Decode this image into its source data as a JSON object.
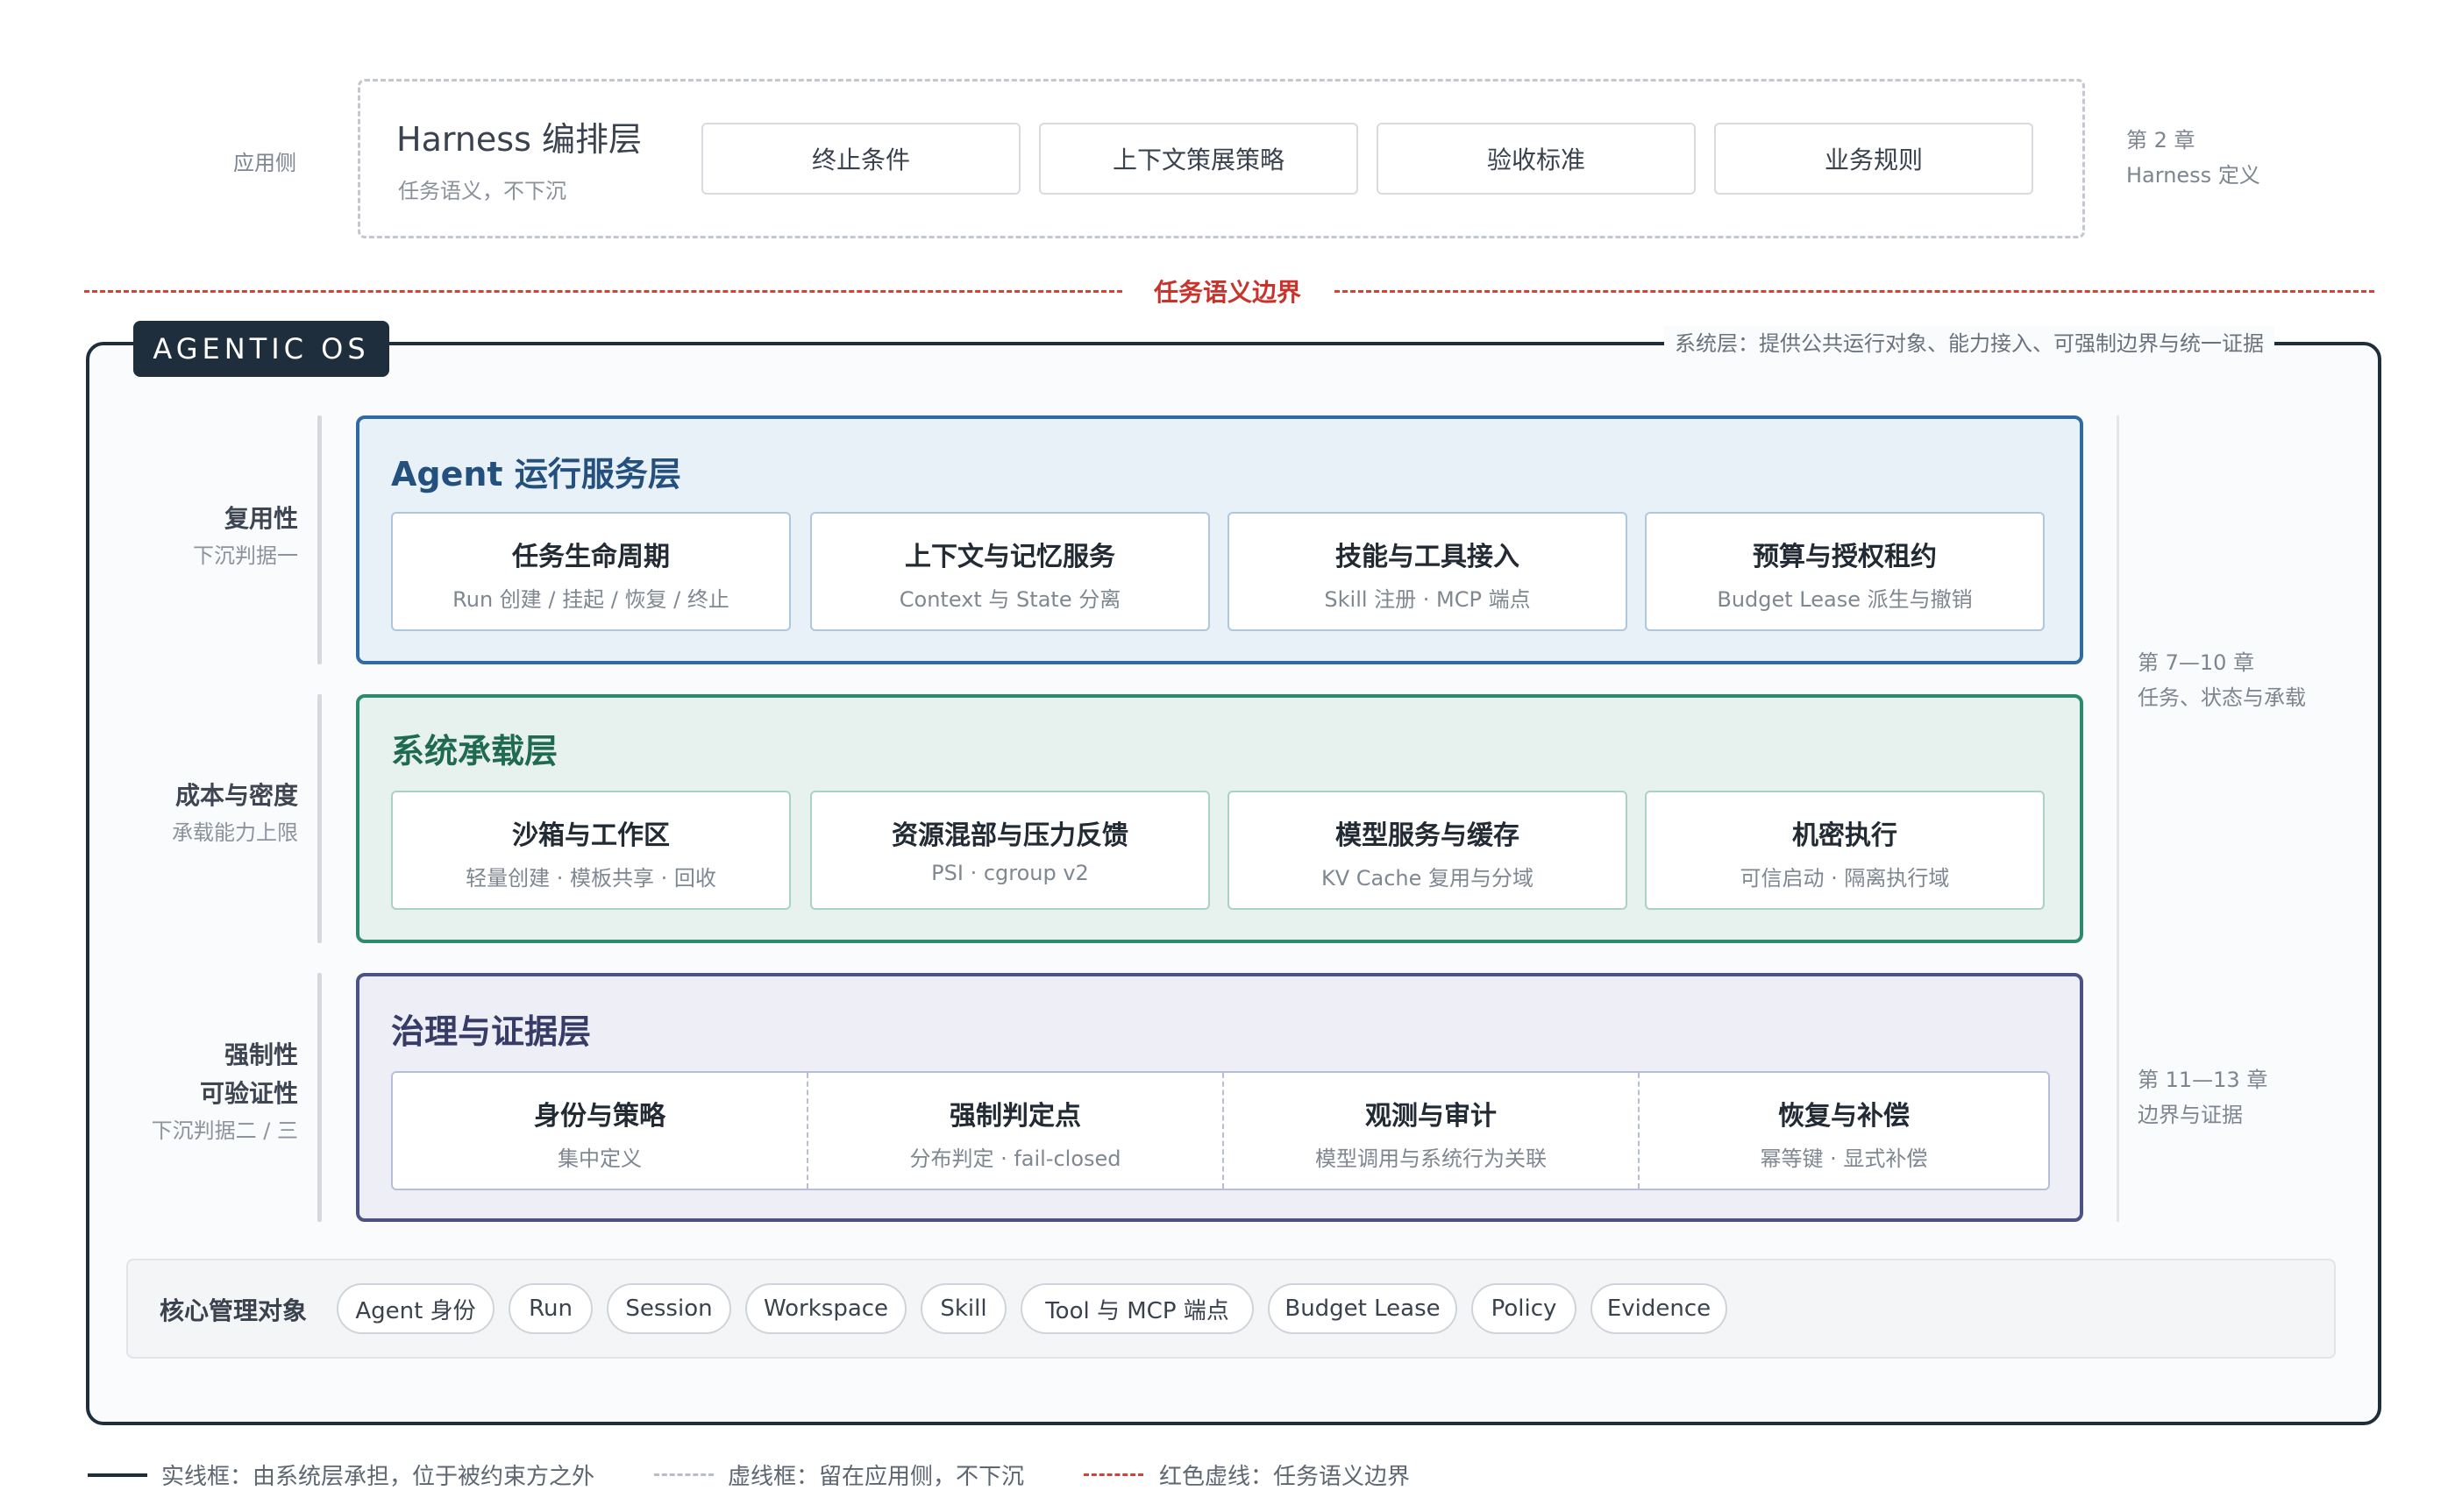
{
  "app_side": {
    "label": "应用侧"
  },
  "harness": {
    "title": "Harness 编排层",
    "subtitle": "任务语义，不下沉",
    "chips": [
      "终止条件",
      "上下文策展策略",
      "验收标准",
      "业务规则"
    ],
    "ref": [
      "第 2 章",
      "Harness 定义"
    ]
  },
  "boundary": {
    "label": "任务语义边界",
    "color": "#d4413a"
  },
  "os": {
    "tag": "AGENTIC OS",
    "note": "系统层：提供公共运行对象、能力接入、可强制边界与统一证据"
  },
  "left_labels": [
    {
      "main": [
        "复用性"
      ],
      "sub": "下沉判据一"
    },
    {
      "main": [
        "成本与密度"
      ],
      "sub": "承载能力上限"
    },
    {
      "main": [
        "强制性",
        "可验证性"
      ],
      "sub": "下沉判据二 / 三"
    }
  ],
  "layers": [
    {
      "title": "Agent 运行服务层",
      "colors": {
        "border": "#2f6aa3",
        "fill": "#e8f0f8",
        "title": "#24507d",
        "card_border": "#aec6df"
      },
      "cards": [
        {
          "title": "任务生命周期",
          "sub": "Run 创建 / 挂起 / 恢复 / 终止"
        },
        {
          "title": "上下文与记忆服务",
          "sub": "Context 与 State 分离"
        },
        {
          "title": "技能与工具接入",
          "sub": "Skill 注册 · MCP 端点"
        },
        {
          "title": "预算与授权租约",
          "sub": "Budget Lease 派生与撤销"
        }
      ]
    },
    {
      "title": "系统承载层",
      "colors": {
        "border": "#2e8a6e",
        "fill": "#e7f2ee",
        "title": "#1f6a51",
        "card_border": "#a9d2c3"
      },
      "cards": [
        {
          "title": "沙箱与工作区",
          "sub": "轻量创建 · 模板共享 · 回收"
        },
        {
          "title": "资源混部与压力反馈",
          "sub": "PSI · cgroup v2"
        },
        {
          "title": "模型服务与缓存",
          "sub": "KV Cache 复用与分域"
        },
        {
          "title": "机密执行",
          "sub": "可信启动 · 隔离执行域"
        }
      ]
    },
    {
      "title": "治理与证据层",
      "colors": {
        "border": "#4b5384",
        "fill": "#eeeff6",
        "title": "#363c66",
        "card_border": "#b9bed8"
      },
      "cards": [
        {
          "title": "身份与策略",
          "sub": "集中定义"
        },
        {
          "title": "强制判定点",
          "sub": "分布判定 · fail-closed"
        },
        {
          "title": "观测与审计",
          "sub": "模型调用与系统行为关联"
        },
        {
          "title": "恢复与补偿",
          "sub": "幂等键 · 显式补偿"
        }
      ]
    }
  ],
  "right_refs": [
    {
      "lines": [
        "第 7—10 章",
        "任务、状态与承载"
      ]
    },
    {
      "lines": [
        "第 11—13 章",
        "边界与证据"
      ]
    }
  ],
  "core_objects": {
    "label": "核心管理对象",
    "items": [
      "Agent 身份",
      "Run",
      "Session",
      "Workspace",
      "Skill",
      "Tool 与 MCP 端点",
      "Budget Lease",
      "Policy",
      "Evidence"
    ]
  },
  "legend": [
    {
      "style": "solid",
      "color": "#1f2e3d",
      "text": "实线框：由系统层承担，位于被约束方之外"
    },
    {
      "style": "dashed",
      "color": "#b9bec6",
      "text": "虚线框：留在应用侧，不下沉"
    },
    {
      "style": "red-dashed",
      "color": "#d4413a",
      "text": "红色虚线：任务语义边界"
    }
  ]
}
